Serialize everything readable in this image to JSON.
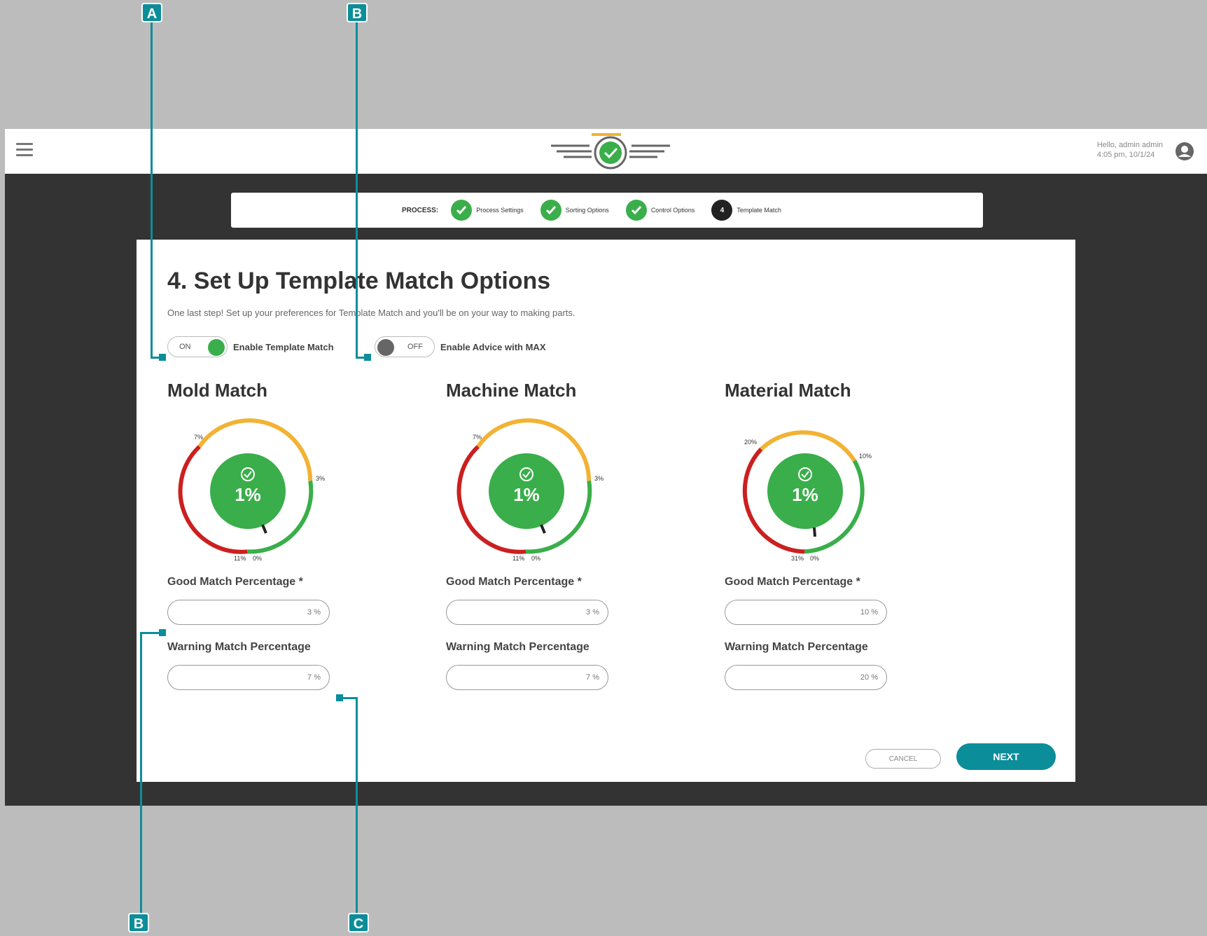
{
  "topbar": {
    "greeting_line1": "Hello, admin admin",
    "greeting_line2": "4:05 pm, 10/1/24"
  },
  "stepper": {
    "process_label": "PROCESS:",
    "steps": [
      {
        "label": "Process Settings",
        "status": "done"
      },
      {
        "label": "Sorting Options",
        "status": "done"
      },
      {
        "label": "Control Options",
        "status": "done"
      },
      {
        "label": "Template Match",
        "status": "current",
        "number": "4"
      }
    ]
  },
  "page": {
    "title": "4. Set Up Template Match Options",
    "subtitle": "One last step! Set up your preferences for Template Match and you'll be on your way to making parts."
  },
  "toggles": {
    "template_match": {
      "state_text": "ON",
      "label": "Enable Template Match",
      "on": true
    },
    "advice_max": {
      "state_text": "OFF",
      "label": "Enable Advice with MAX",
      "on": false
    }
  },
  "columns": [
    {
      "title": "Mold Match",
      "gauge_value": "1%",
      "good_label": "Good Match Percentage *",
      "good_value": "3 %",
      "warning_label": "Warning Match Percentage",
      "warning_value": "7 %",
      "labels": {
        "left_top": "7%",
        "right": "3%",
        "bottom_left": "11%",
        "bottom_right": "0%"
      }
    },
    {
      "title": "Machine Match",
      "gauge_value": "1%",
      "good_label": "Good Match Percentage *",
      "good_value": "3 %",
      "warning_label": "Warning Match Percentage",
      "warning_value": "7 %",
      "labels": {
        "left_top": "7%",
        "right": "3%",
        "bottom_left": "11%",
        "bottom_right": "0%"
      }
    },
    {
      "title": "Material Match",
      "gauge_value": "1%",
      "good_label": "Good Match Percentage *",
      "good_value": "10 %",
      "warning_label": "Warning Match Percentage",
      "warning_value": "20 %",
      "labels": {
        "left_top": "20%",
        "right": "10%",
        "bottom_left": "31%",
        "bottom_right": "0%"
      }
    }
  ],
  "actions": {
    "cancel_label": "CANCEL",
    "next_label": "NEXT"
  },
  "callouts": {
    "a_top": "A",
    "b_top": "B",
    "b_bottom": "B",
    "c_bottom": "C"
  },
  "colors": {
    "accent": "#0c8d9a",
    "good": "#3aae4a",
    "warning": "#f2b233",
    "bad": "#cc1f1f"
  }
}
